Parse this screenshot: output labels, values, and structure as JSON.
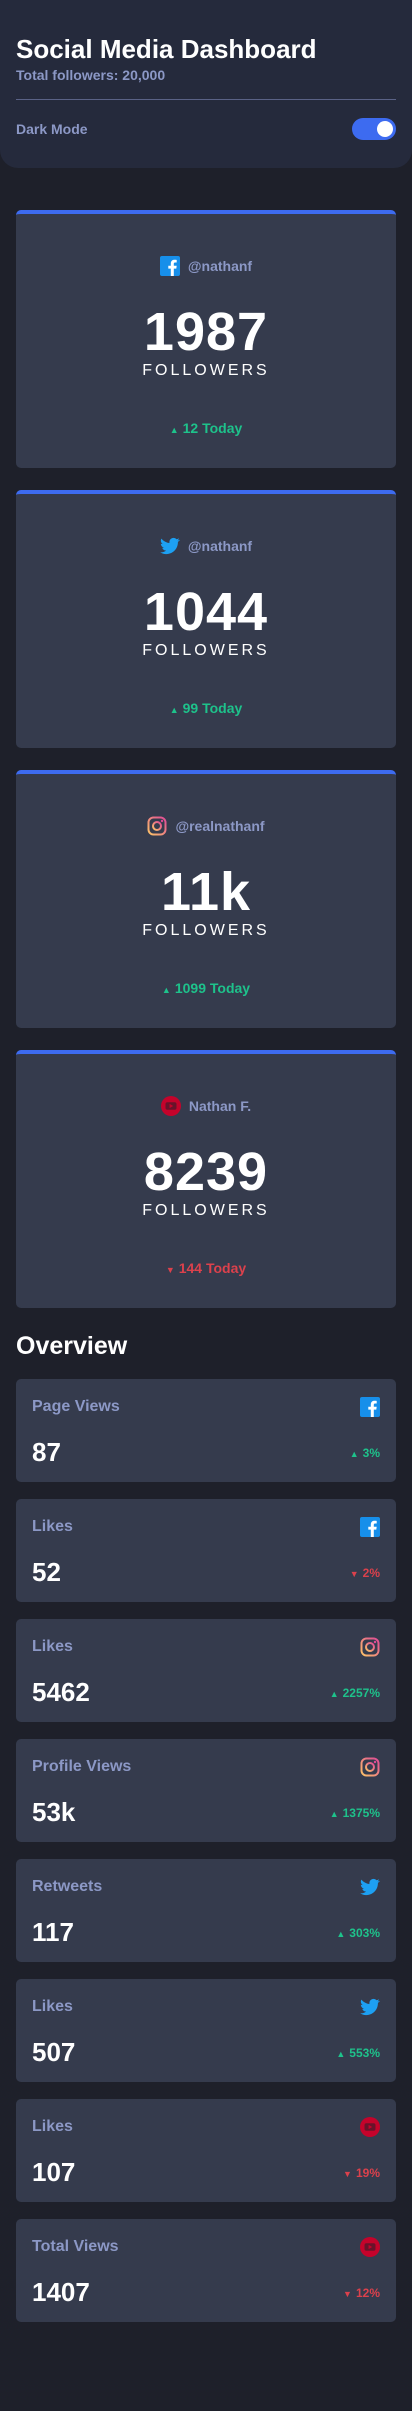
{
  "header": {
    "title": "Social Media Dashboard",
    "subtitle": "Total followers: 20,000",
    "mode_label": "Dark Mode",
    "mode_on": true
  },
  "colors": {
    "accent": "#3d6bf0",
    "up": "#1ec28b",
    "down": "#dc414c",
    "facebook": "#178fea",
    "twitter": "#1da0f2",
    "youtube": "#c4032b",
    "instagram": "#e9756a"
  },
  "cards": [
    {
      "platform_icon": "facebook-icon",
      "handle": "@nathanf",
      "count": "1987",
      "label": "FOLLOWERS",
      "today": "12 Today",
      "trend": "up"
    },
    {
      "platform_icon": "twitter-icon",
      "handle": "@nathanf",
      "count": "1044",
      "label": "FOLLOWERS",
      "today": "99 Today",
      "trend": "up"
    },
    {
      "platform_icon": "instagram-icon",
      "handle": "@realnathanf",
      "count": "11k",
      "label": "FOLLOWERS",
      "today": "1099 Today",
      "trend": "up"
    },
    {
      "platform_icon": "youtube-icon",
      "handle": "Nathan F.",
      "count": "8239",
      "label": "FOLLOWERS",
      "today": "144 Today",
      "trend": "down"
    }
  ],
  "overview": {
    "title": "Overview",
    "stats": [
      {
        "label": "Page Views",
        "value": "87",
        "change": "3%",
        "trend": "up",
        "icon": "facebook-icon"
      },
      {
        "label": "Likes",
        "value": "52",
        "change": "2%",
        "trend": "down",
        "icon": "facebook-icon"
      },
      {
        "label": "Likes",
        "value": "5462",
        "change": "2257%",
        "trend": "up",
        "icon": "instagram-icon"
      },
      {
        "label": "Profile Views",
        "value": "53k",
        "change": "1375%",
        "trend": "up",
        "icon": "instagram-icon"
      },
      {
        "label": "Retweets",
        "value": "117",
        "change": "303%",
        "trend": "up",
        "icon": "twitter-icon"
      },
      {
        "label": "Likes",
        "value": "507",
        "change": "553%",
        "trend": "up",
        "icon": "twitter-icon"
      },
      {
        "label": "Likes",
        "value": "107",
        "change": "19%",
        "trend": "down",
        "icon": "youtube-icon"
      },
      {
        "label": "Total Views",
        "value": "1407",
        "change": "12%",
        "trend": "down",
        "icon": "youtube-icon"
      }
    ]
  }
}
